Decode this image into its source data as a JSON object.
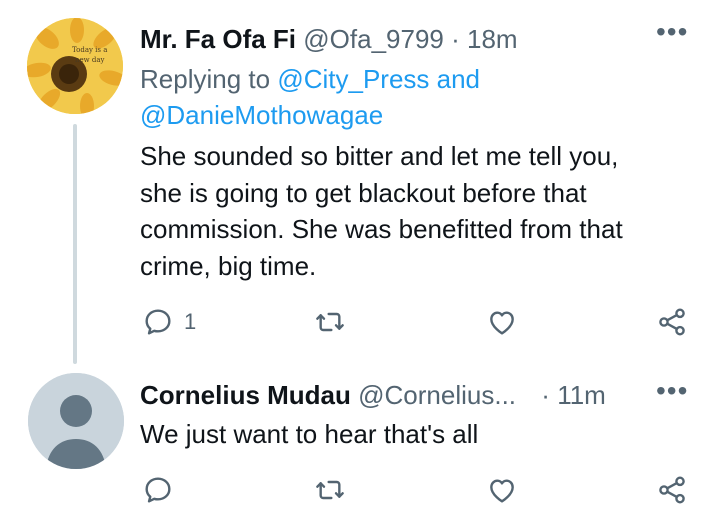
{
  "tweets": [
    {
      "name": "Mr. Fa Ofa Fi",
      "handle": "@Ofa_9799",
      "separator": "·",
      "time": "18m",
      "reply_prefix": "Replying to",
      "reply_mention_1": "@City_Press",
      "reply_and": "and",
      "reply_mention_2": "@DanieMothowagae",
      "avatar_text_1": "Today is a",
      "avatar_text_2": "new day",
      "lines": [
        "She sounded so bitter and let me tell you,",
        "she is going to get blackout before that",
        "commission. She was benefitted from that",
        "crime, big time."
      ],
      "reply_count": "1",
      "more": "•••"
    },
    {
      "name": "Cornelius Mudau",
      "handle": "@Cornelius...",
      "separator": "·",
      "time": "11m",
      "lines": [
        "We just want to hear that's all"
      ],
      "more": "•••"
    }
  ],
  "colors": {
    "accent": "#1d9bf0",
    "muted": "#536471",
    "text": "#0f1419",
    "line": "#cfd9de"
  },
  "icons": [
    "reply-icon",
    "retweet-icon",
    "like-icon",
    "share-icon",
    "more-icon"
  ]
}
